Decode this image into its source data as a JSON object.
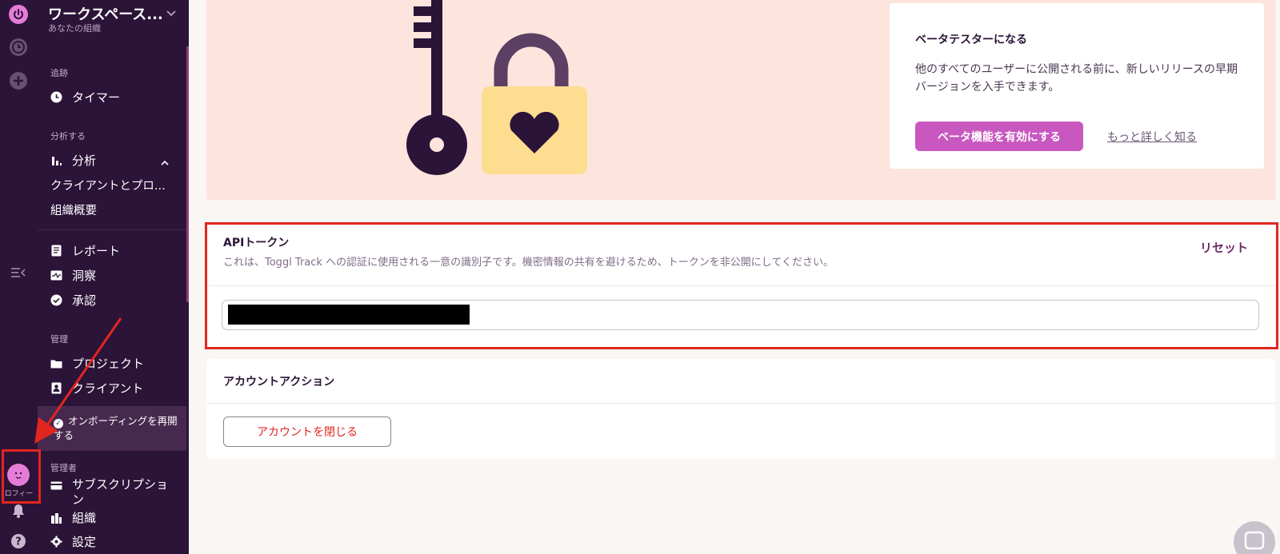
{
  "rail": {
    "avatar_label": "ロフィー"
  },
  "sidebar": {
    "workspace_title": "ワークスペース...",
    "workspace_sub": "あなたの組織",
    "sections": {
      "track": "追跡",
      "analyze": "分析する",
      "manage": "管理",
      "admin": "管理者"
    },
    "items": {
      "timer": "タイマー",
      "analytics": "分析",
      "clients_projects": "クライアントとプロ...",
      "org_overview": "組織概要",
      "reports": "レポート",
      "insights": "洞察",
      "approvals": "承認",
      "projects": "プロジェクト",
      "clients": "クライアント",
      "subscription": "サブスクリプション",
      "organization": "組織",
      "settings": "設定"
    },
    "onboarding": "オンボーディングを再開する"
  },
  "beta": {
    "title": "ベータテスターになる",
    "description": "他のすべてのユーザーに公開される前に、新しいリリースの早期バージョンを入手できます。",
    "button": "ベータ機能を有効にする",
    "link": "もっと詳しく知る"
  },
  "api": {
    "title": "APIトークン",
    "description": "これは、Toggl Track への認証に使用される一意の識別子です。機密情報の共有を避けるため、トークンを非公開にしてください。",
    "reset": "リセット",
    "token_value": ""
  },
  "account": {
    "title": "アカウントアクション",
    "close_button": "アカウントを閉じる"
  },
  "colors": {
    "sidebar_bg": "#2c1338",
    "accent": "#c957c0",
    "hero_bg": "#fde5dd",
    "annotation_red": "#e1261f"
  }
}
